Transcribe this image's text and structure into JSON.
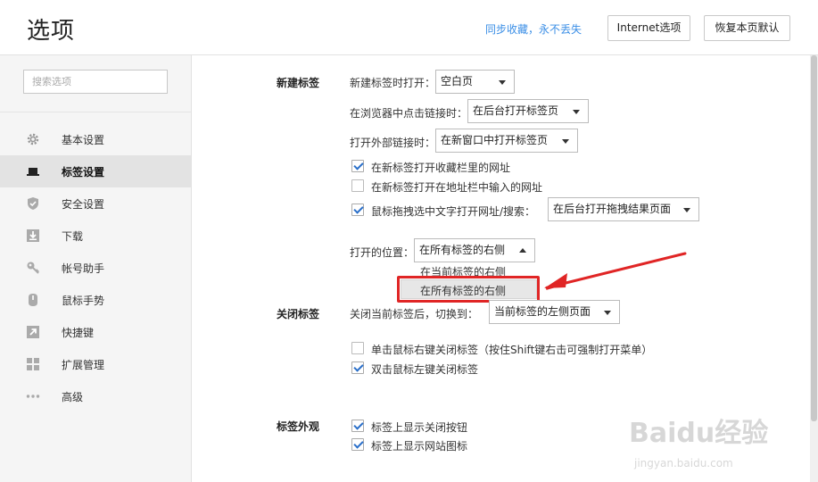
{
  "header": {
    "title": "选项",
    "sync_link": "同步收藏，永不丢失",
    "internet_button": "Internet选项",
    "restore_button": "恢复本页默认"
  },
  "sidebar": {
    "search_placeholder": "搜索选项",
    "items": [
      {
        "label": "基本设置",
        "icon": "gear-icon"
      },
      {
        "label": "标签设置",
        "icon": "laptop-icon",
        "active": true
      },
      {
        "label": "安全设置",
        "icon": "shield-check-icon"
      },
      {
        "label": "下载",
        "icon": "download-icon"
      },
      {
        "label": "帐号助手",
        "icon": "key-icon"
      },
      {
        "label": "鼠标手势",
        "icon": "mouse-icon"
      },
      {
        "label": "快捷键",
        "icon": "shortcut-arrow-icon"
      },
      {
        "label": "扩展管理",
        "icon": "grid-icon"
      },
      {
        "label": "高级",
        "icon": "more-dots-icon"
      }
    ]
  },
  "new_tab": {
    "section_title": "新建标签",
    "open_label": "新建标签时打开：",
    "open_value": "空白页",
    "click_link_label": "在浏览器中点击链接时：",
    "click_link_value": "在后台打开标签页",
    "external_link_label": "打开外部链接时：",
    "external_link_value": "在新窗口中打开标签页",
    "checkbox_bookmarks": "在新标签打开收藏栏里的网址",
    "checkbox_bookmarks_checked": true,
    "checkbox_addressbar": "在新标签打开在地址栏中输入的网址",
    "checkbox_addressbar_checked": false,
    "checkbox_drag": "鼠标拖拽选中文字打开网址/搜索：",
    "checkbox_drag_checked": true,
    "drag_value": "在后台打开拖拽结果页面",
    "position_label": "打开的位置：",
    "position_value": "在所有标签的右侧",
    "position_options": [
      "在当前标签的右侧",
      "在所有标签的右侧"
    ]
  },
  "close_tab": {
    "section_title": "关闭标签",
    "switch_label": "关闭当前标签后，切换到：",
    "switch_value": "当前标签的左侧页面",
    "checkbox_right_click": "单击鼠标右键关闭标签（按住Shift键右击可强制打开菜单）",
    "checkbox_right_click_checked": false,
    "checkbox_double_click": "双击鼠标左键关闭标签",
    "checkbox_double_click_checked": true
  },
  "tab_appearance": {
    "section_title": "标签外观",
    "checkbox_close_button": "标签上显示关闭按钮",
    "checkbox_close_button_checked": true,
    "checkbox_favicon": "标签上显示网站图标",
    "checkbox_favicon_checked": true
  },
  "watermark": {
    "main": "Baidu经验",
    "sub": "jingyan.baidu.com"
  },
  "colors": {
    "accent": "#3a8ee6",
    "check": "#2a6fc9",
    "annotation": "#e02525"
  }
}
